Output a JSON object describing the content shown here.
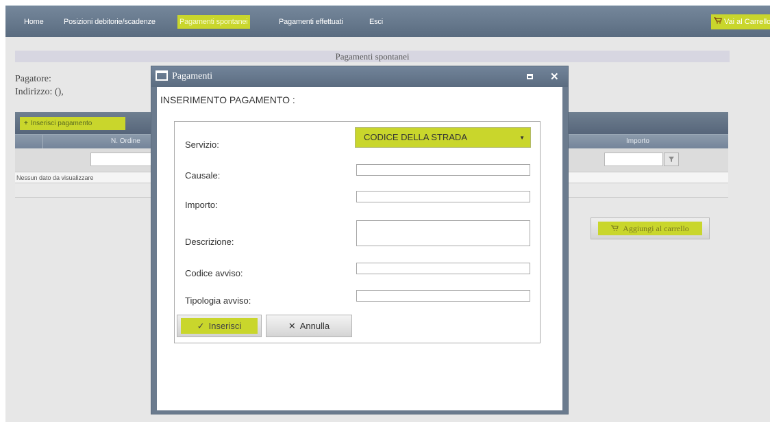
{
  "nav": {
    "home": "Home",
    "posizioni": "Posizioni debitorie/scadenze",
    "pagamenti_spontanei": "Pagamenti spontanei",
    "pagamenti_effettuati": "Pagamenti effettuati",
    "esci": "Esci",
    "cart": "Vai al Carrello"
  },
  "page": {
    "title": "Pagamenti spontanei",
    "pagatore_label": "Pagatore:",
    "indirizzo_label": "Indirizzo: (),",
    "insert_button": "Inserisci pagamento",
    "col_ordine": "N. Ordine",
    "col_importo": "Importo",
    "empty_text": "Nessun dato da visualizzare",
    "add_cart_button": "Aggiungi al carrello"
  },
  "dialog": {
    "title": "Pagamenti",
    "heading": "INSERIMENTO PAGAMENTO :",
    "fields": {
      "servizio_label": "Servizio:",
      "servizio_value": "CODICE DELLA STRADA",
      "causale_label": "Causale:",
      "causale_value": "",
      "importo_label": "Importo:",
      "importo_value": "",
      "descrizione_label": "Descrizione:",
      "descrizione_value": "",
      "codice_avviso_label": "Codice avviso:",
      "codice_avviso_value": "",
      "tipologia_avviso_label": "Tipologia avviso:",
      "tipologia_avviso_value": ""
    },
    "buttons": {
      "inserisci": "Inserisci",
      "annulla": "Annulla"
    }
  },
  "colors": {
    "accent": "#c9d62c",
    "header": "#5f7185",
    "background": "#e7e7e7"
  }
}
